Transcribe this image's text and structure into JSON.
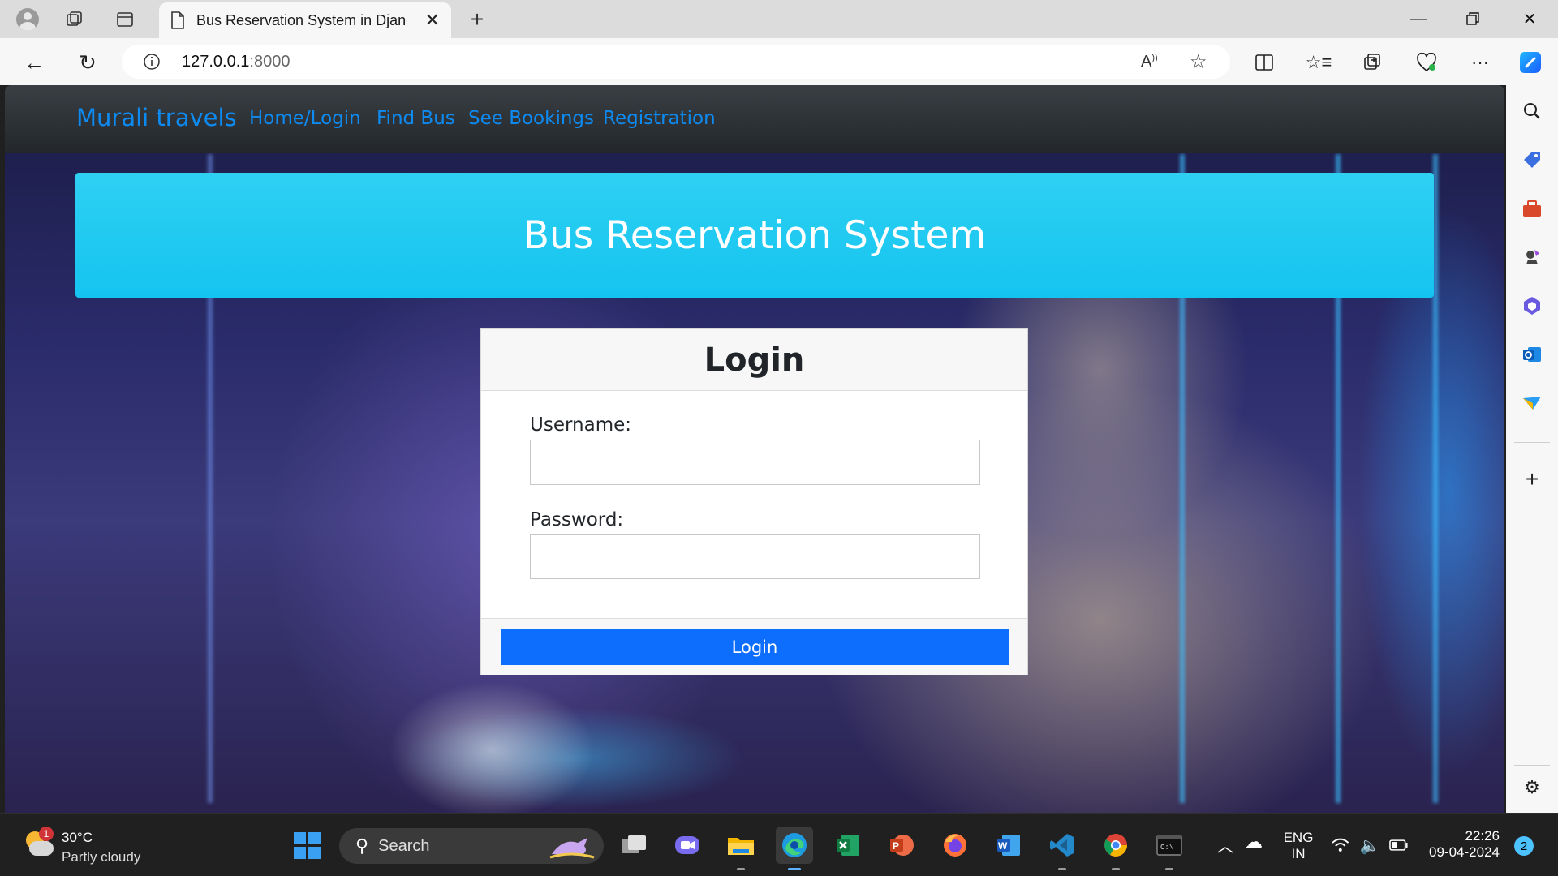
{
  "browser": {
    "tab_title": "Bus Reservation System in Django",
    "url_host": "127.0.0.1",
    "url_port": ":8000"
  },
  "page": {
    "brand": "Murali travels",
    "nav_links": [
      "Home/Login",
      "Find Bus",
      "See Bookings",
      "Registration"
    ],
    "jumbotron_title": "Bus Reservation System",
    "login": {
      "title": "Login",
      "username_label": "Username:",
      "password_label": "Password:",
      "button_label": "Login",
      "username_value": "",
      "password_value": ""
    }
  },
  "taskbar": {
    "weather_temp": "30°C",
    "weather_condition": "Partly cloudy",
    "weather_badge": "1",
    "search_label": "Search",
    "lang_line1": "ENG",
    "lang_line2": "IN",
    "time": "22:26",
    "date": "09-04-2024",
    "notification_count": "2"
  },
  "colors": {
    "accent_link": "#0d8bf2",
    "jumbotron": "#1cc8f2",
    "primary_button": "#0d6efd"
  }
}
